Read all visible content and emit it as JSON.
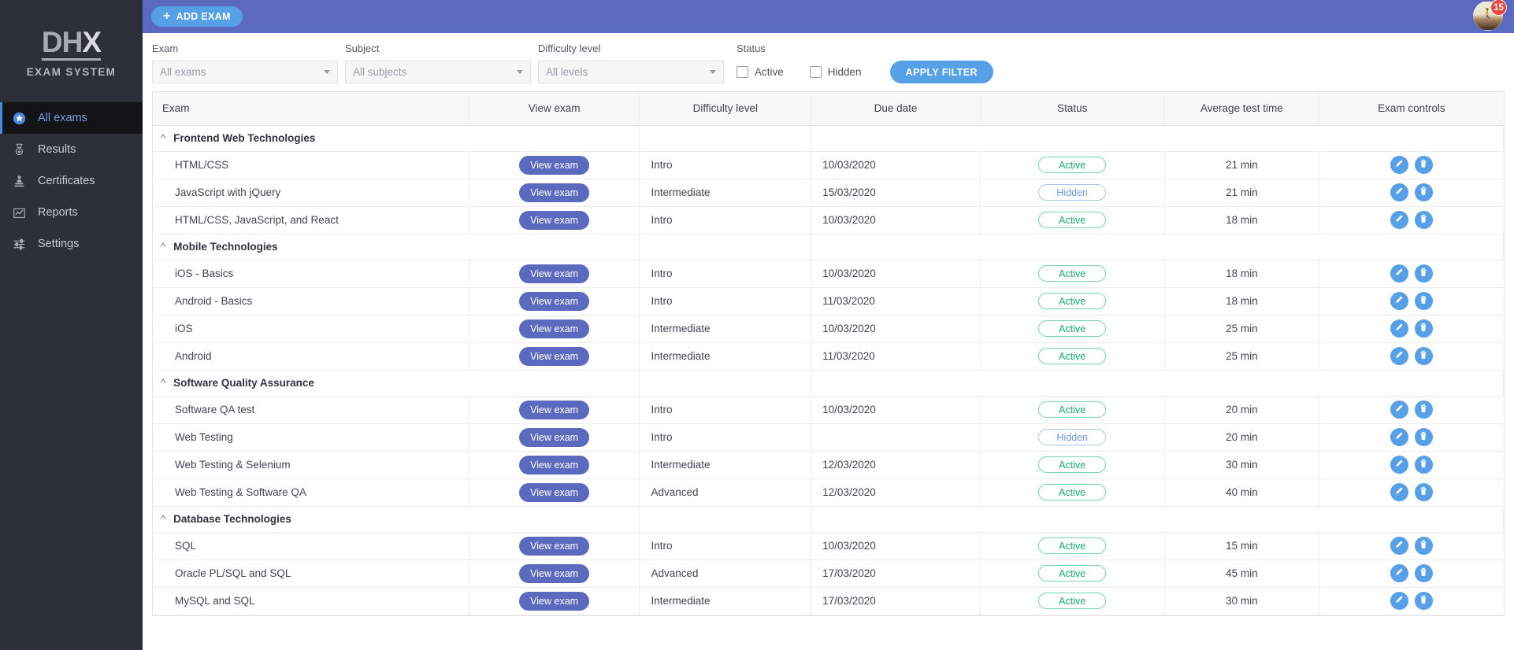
{
  "brand": {
    "logo_dh": "DH",
    "logo_x": "X",
    "subtitle": "EXAM SYSTEM"
  },
  "sidebar": {
    "items": [
      {
        "label": "All exams",
        "icon": "star-circle-icon",
        "active": true
      },
      {
        "label": "Results",
        "icon": "medal-icon",
        "active": false
      },
      {
        "label": "Certificates",
        "icon": "stamp-icon",
        "active": false
      },
      {
        "label": "Reports",
        "icon": "chart-icon",
        "active": false
      },
      {
        "label": "Settings",
        "icon": "sliders-icon",
        "active": false
      }
    ]
  },
  "topbar": {
    "add_exam_label": "ADD EXAM",
    "add_icon": "plus-icon",
    "notification_count": "15",
    "avatar_icon": "user-avatar",
    "bar_color": "#5b6abf",
    "button_color": "#56a0e8"
  },
  "filters": {
    "exam": {
      "label": "Exam",
      "value": "All exams"
    },
    "subject": {
      "label": "Subject",
      "value": "All subjects"
    },
    "difficulty": {
      "label": "Difficulty level",
      "value": "All levels"
    },
    "status": {
      "label": "Status",
      "checkboxes": [
        {
          "label": "Active",
          "checked": false
        },
        {
          "label": "Hidden",
          "checked": false
        }
      ]
    },
    "apply_label": "APPLY FILTER"
  },
  "table": {
    "columns": [
      "Exam",
      "View exam",
      "Difficulty level",
      "Due date",
      "Status",
      "Average test time",
      "Exam controls"
    ],
    "view_exam_label": "View exam",
    "edit_icon": "pencil-icon",
    "delete_icon": "trash-icon",
    "collapse_icon": "chevron-up-icon",
    "groups": [
      {
        "name": "Frontend Web Technologies",
        "rows": [
          {
            "exam": "HTML/CSS",
            "difficulty": "Intro",
            "due": "10/03/2020",
            "status": "Active",
            "avg": "21 min"
          },
          {
            "exam": "JavaScript with jQuery",
            "difficulty": "Intermediate",
            "due": "15/03/2020",
            "status": "Hidden",
            "avg": "21 min"
          },
          {
            "exam": "HTML/CSS, JavaScript, and React",
            "difficulty": "Intro",
            "due": "10/03/2020",
            "status": "Active",
            "avg": "18 min"
          }
        ]
      },
      {
        "name": "Mobile Technologies",
        "rows": [
          {
            "exam": "iOS - Basics",
            "difficulty": "Intro",
            "due": "10/03/2020",
            "status": "Active",
            "avg": "18 min"
          },
          {
            "exam": "Android - Basics",
            "difficulty": "Intro",
            "due": "11/03/2020",
            "status": "Active",
            "avg": "18 min"
          },
          {
            "exam": "iOS",
            "difficulty": "Intermediate",
            "due": "10/03/2020",
            "status": "Active",
            "avg": "25 min"
          },
          {
            "exam": "Android",
            "difficulty": "Intermediate",
            "due": "11/03/2020",
            "status": "Active",
            "avg": "25 min"
          }
        ]
      },
      {
        "name": "Software Quality Assurance",
        "rows": [
          {
            "exam": "Software QA test",
            "difficulty": "Intro",
            "due": "10/03/2020",
            "status": "Active",
            "avg": "20 min"
          },
          {
            "exam": "Web Testing",
            "difficulty": "Intro",
            "due": "",
            "status": "Hidden",
            "avg": "20 min"
          },
          {
            "exam": "Web Testing & Selenium",
            "difficulty": "Intermediate",
            "due": "12/03/2020",
            "status": "Active",
            "avg": "30 min"
          },
          {
            "exam": "Web Testing & Software QA",
            "difficulty": "Advanced",
            "due": "12/03/2020",
            "status": "Active",
            "avg": "40 min"
          }
        ]
      },
      {
        "name": "Database Technologies",
        "rows": [
          {
            "exam": "SQL",
            "difficulty": "Intro",
            "due": "10/03/2020",
            "status": "Active",
            "avg": "15 min"
          },
          {
            "exam": "Oracle PL/SQL and SQL",
            "difficulty": "Advanced",
            "due": "17/03/2020",
            "status": "Active",
            "avg": "45 min"
          },
          {
            "exam": "MySQL and SQL",
            "difficulty": "Intermediate",
            "due": "17/03/2020",
            "status": "Active",
            "avg": "30 min"
          }
        ]
      }
    ]
  },
  "colors": {
    "sidebar_bg": "#2b303b",
    "accent_blue": "#56a0e8",
    "purple": "#5b6abf",
    "active_green": "#16b16b",
    "hidden_blue": "#6b9ae0",
    "badge_red": "#e8453c"
  }
}
